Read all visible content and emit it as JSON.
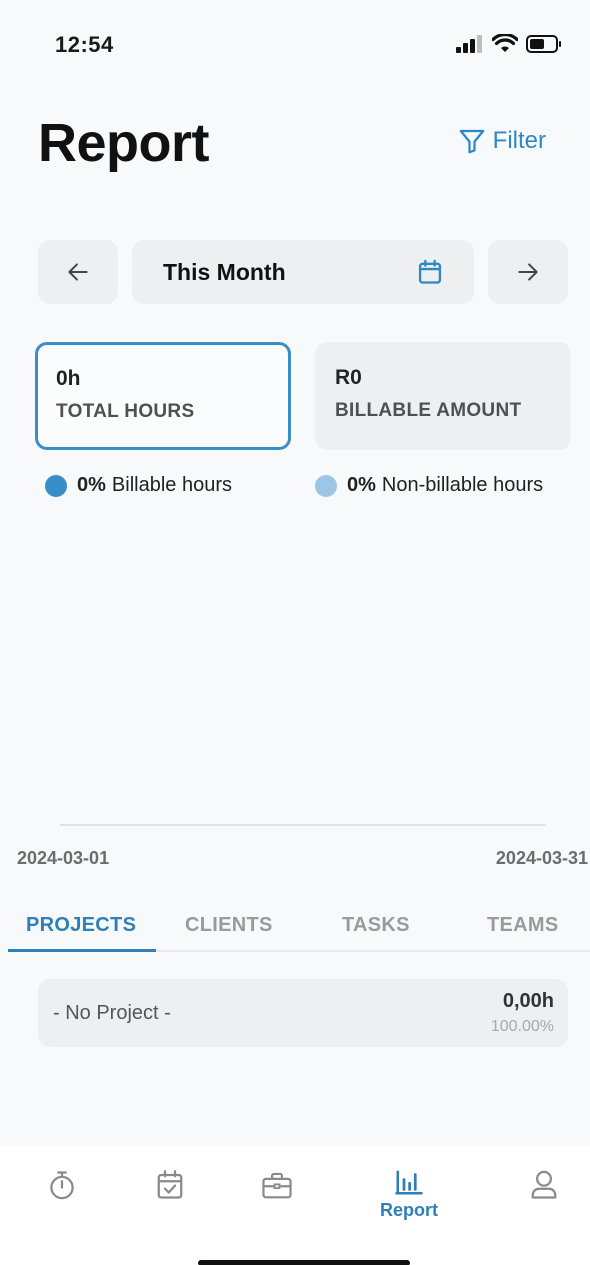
{
  "status_bar": {
    "time": "12:54"
  },
  "header": {
    "title": "Report",
    "filter_label": "Filter"
  },
  "period": {
    "label": "This Month"
  },
  "summary": {
    "total": {
      "value": "0h",
      "label": "TOTAL HOURS"
    },
    "billable": {
      "value": "R0",
      "label": "BILLABLE AMOUNT"
    }
  },
  "legend": {
    "billable": {
      "percent": "0%",
      "label": "Billable hours",
      "color": "#3a8ec7"
    },
    "nonbillable": {
      "percent": "0%",
      "label": "Non-billable hours",
      "color": "#9cc6e3"
    }
  },
  "chart_data": {
    "type": "bar",
    "x": [
      "2024-03-01",
      "2024-03-31"
    ],
    "start_label": "2024-03-01",
    "end_label": "2024-03-31"
  },
  "tabs": [
    {
      "label": "PROJECTS",
      "active": true
    },
    {
      "label": "CLIENTS",
      "active": false
    },
    {
      "label": "TASKS",
      "active": false
    },
    {
      "label": "TEAMS",
      "active": false
    }
  ],
  "projects": [
    {
      "name": "- No Project -",
      "hours": "0,00h",
      "percent": "100.00%"
    }
  ],
  "nav": {
    "items": [
      {
        "icon": "stopwatch-icon"
      },
      {
        "icon": "calendar-check-icon"
      },
      {
        "icon": "briefcase-icon"
      },
      {
        "icon": "bar-chart-icon",
        "label": "Report",
        "active": true
      },
      {
        "icon": "user-icon"
      }
    ]
  },
  "colors": {
    "accent": "#2f7fb8"
  }
}
